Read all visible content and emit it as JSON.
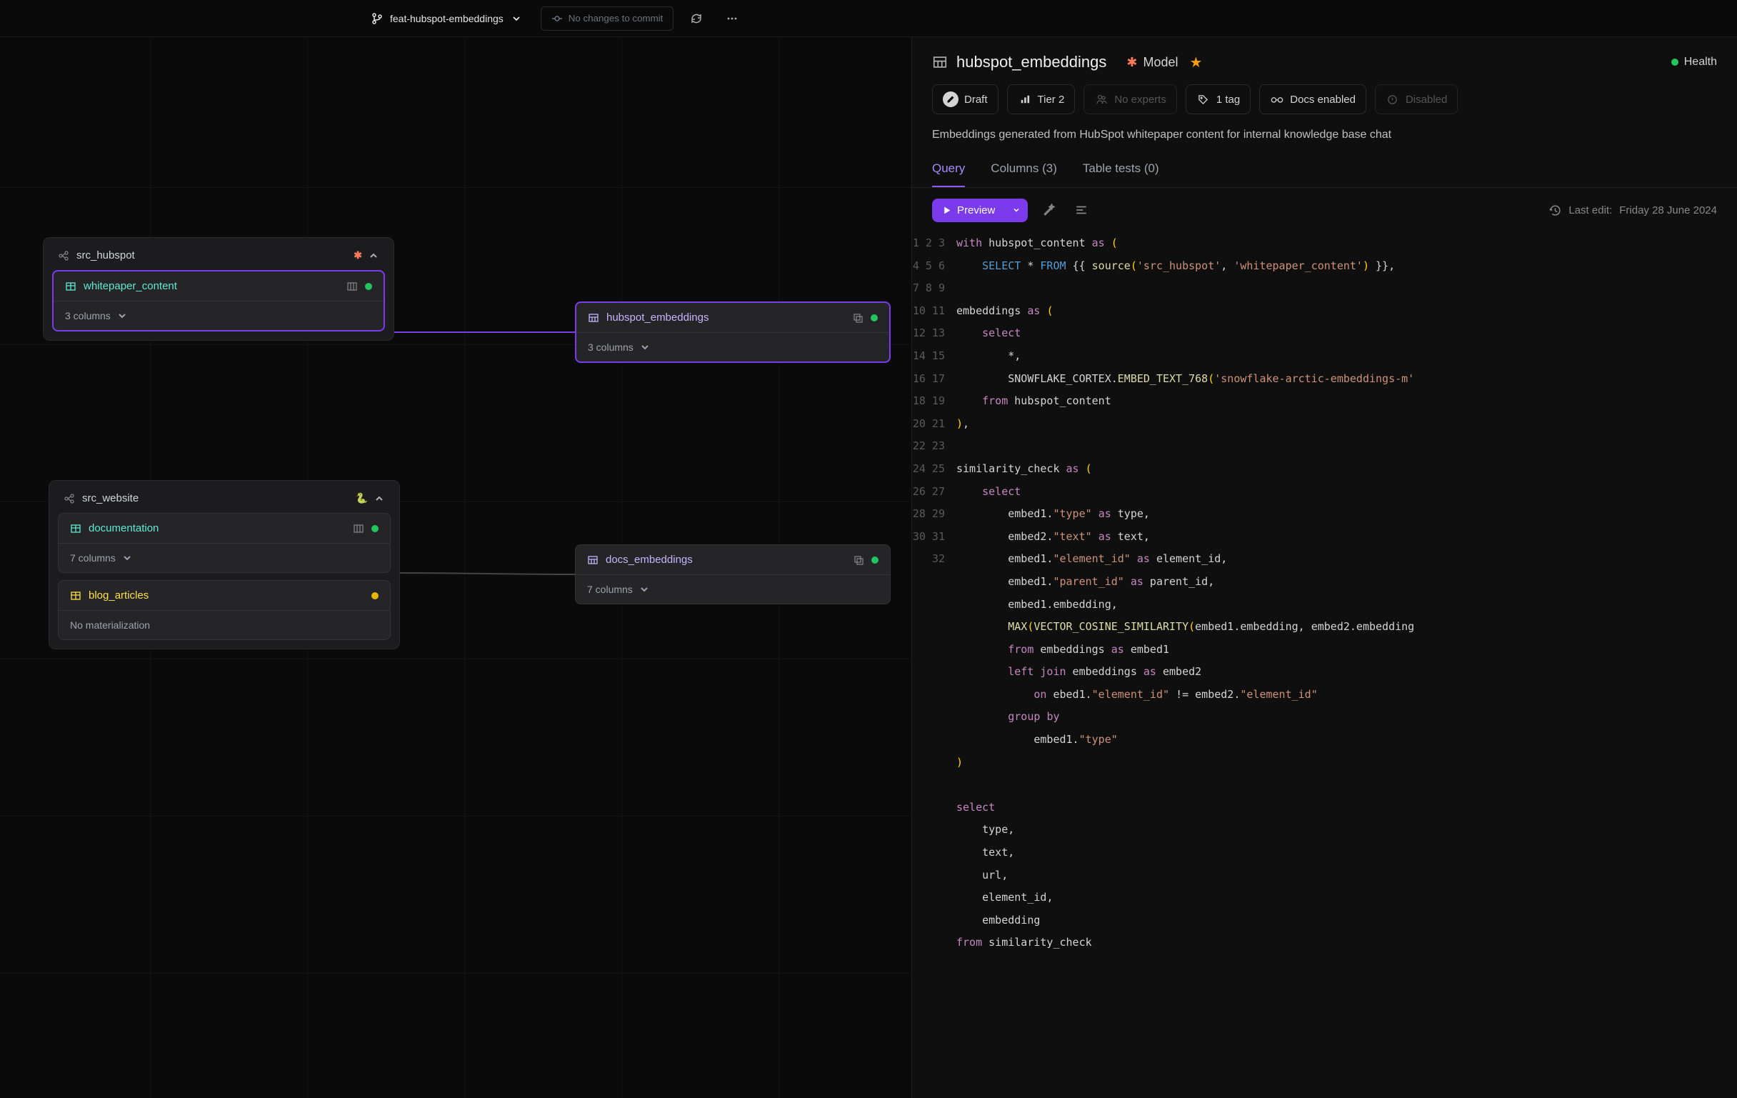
{
  "topbar": {
    "branch": "feat-hubspot-embeddings",
    "commit_msg": "No changes to commit"
  },
  "canvas": {
    "groups": [
      {
        "id": "grp-src-hubspot",
        "title": "src_hubspot",
        "logo": "hubspot",
        "nodes": [
          {
            "id": "whitepaper_content",
            "title": "whitepaper_content",
            "color": "teal",
            "sub": "3 columns",
            "status": "green",
            "selected": true,
            "icon": "table",
            "right_icon": "db"
          }
        ]
      },
      {
        "id": "grp-src-website",
        "title": "src_website",
        "logo": "python",
        "nodes": [
          {
            "id": "documentation",
            "title": "documentation",
            "color": "teal",
            "sub": "7 columns",
            "status": "green",
            "icon": "table",
            "right_icon": "db"
          },
          {
            "id": "blog_articles",
            "title": "blog_articles",
            "color": "yellow",
            "sub": "No materialization",
            "status": "yellow",
            "icon": "table",
            "plain": true
          }
        ]
      }
    ],
    "free_nodes": [
      {
        "id": "hubspot_embeddings",
        "title": "hubspot_embeddings",
        "color": "purple",
        "sub": "3 columns",
        "status": "green",
        "selected": true,
        "icon": "sql",
        "right_icon": "copy"
      },
      {
        "id": "docs_embeddings",
        "title": "docs_embeddings",
        "color": "purple",
        "sub": "7 columns",
        "status": "green",
        "icon": "sql",
        "right_icon": "copy"
      }
    ]
  },
  "panel": {
    "name": "hubspot_embeddings",
    "type": "Model",
    "health": "Health",
    "chips": {
      "draft": "Draft",
      "tier": "Tier 2",
      "experts": "No experts",
      "tag": "1 tag",
      "docs": "Docs enabled",
      "disabled": "Disabled"
    },
    "description": "Embeddings generated from HubSpot whitepaper content for internal knowledge base chat",
    "tabs": {
      "query": "Query",
      "columns": "Columns (3)",
      "tests": "Table tests (0)"
    },
    "toolbar": {
      "preview": "Preview",
      "last_edit_label": "Last edit:",
      "last_edit_value": "Friday 28 June 2024"
    },
    "code": {
      "lines": 32,
      "content_tokens": [
        [
          [
            "kw",
            "with"
          ],
          [
            "pl",
            " hubspot_content "
          ],
          [
            "kw",
            "as"
          ],
          [
            "pl",
            " "
          ],
          [
            "paren",
            "("
          ]
        ],
        [
          [
            "pl",
            "    "
          ],
          [
            "kw2",
            "SELECT"
          ],
          [
            "pl",
            " "
          ],
          [
            "pun",
            "*"
          ],
          [
            "pl",
            " "
          ],
          [
            "kw2",
            "FROM"
          ],
          [
            "pl",
            " "
          ],
          [
            "pun",
            "{{"
          ],
          [
            "pl",
            " "
          ],
          [
            "fn",
            "source"
          ],
          [
            "paren",
            "("
          ],
          [
            "str",
            "'src_hubspot'"
          ],
          [
            "pun",
            ", "
          ],
          [
            "str",
            "'whitepaper_content'"
          ],
          [
            "paren",
            ")"
          ],
          [
            "pl",
            " "
          ],
          [
            "pun",
            "}}"
          ],
          [
            "pun",
            ","
          ]
        ],
        [],
        [
          [
            "pl",
            "embeddings "
          ],
          [
            "kw",
            "as"
          ],
          [
            "pl",
            " "
          ],
          [
            "paren",
            "("
          ]
        ],
        [
          [
            "pl",
            "    "
          ],
          [
            "kw",
            "select"
          ]
        ],
        [
          [
            "pl",
            "        "
          ],
          [
            "pun",
            "*"
          ],
          [
            "pun",
            ","
          ]
        ],
        [
          [
            "pl",
            "        SNOWFLAKE_CORTEX"
          ],
          [
            "pun",
            "."
          ],
          [
            "fn",
            "EMBED_TEXT_768"
          ],
          [
            "paren",
            "("
          ],
          [
            "str",
            "'snowflake-arctic-embeddings-m'"
          ]
        ],
        [
          [
            "pl",
            "    "
          ],
          [
            "kw",
            "from"
          ],
          [
            "pl",
            " hubspot_content"
          ]
        ],
        [
          [
            "paren",
            ")"
          ],
          [
            "pun",
            ","
          ]
        ],
        [],
        [
          [
            "pl",
            "similarity_check "
          ],
          [
            "kw",
            "as"
          ],
          [
            "pl",
            " "
          ],
          [
            "paren",
            "("
          ]
        ],
        [
          [
            "pl",
            "    "
          ],
          [
            "kw",
            "select"
          ]
        ],
        [
          [
            "pl",
            "        embed1."
          ],
          [
            "str",
            "\"type\""
          ],
          [
            "pl",
            " "
          ],
          [
            "kw",
            "as"
          ],
          [
            "pl",
            " type"
          ],
          [
            "pun",
            ","
          ]
        ],
        [
          [
            "pl",
            "        embed2."
          ],
          [
            "str",
            "\"text\""
          ],
          [
            "pl",
            " "
          ],
          [
            "kw",
            "as"
          ],
          [
            "pl",
            " text"
          ],
          [
            "pun",
            ","
          ]
        ],
        [
          [
            "pl",
            "        embed1."
          ],
          [
            "str",
            "\"element_id\""
          ],
          [
            "pl",
            " "
          ],
          [
            "kw",
            "as"
          ],
          [
            "pl",
            " element_id"
          ],
          [
            "pun",
            ","
          ]
        ],
        [
          [
            "pl",
            "        embed1."
          ],
          [
            "str",
            "\"parent_id\""
          ],
          [
            "pl",
            " "
          ],
          [
            "kw",
            "as"
          ],
          [
            "pl",
            " parent_id"
          ],
          [
            "pun",
            ","
          ]
        ],
        [
          [
            "pl",
            "        embed1.embedding"
          ],
          [
            "pun",
            ","
          ]
        ],
        [
          [
            "pl",
            "        "
          ],
          [
            "fn",
            "MAX"
          ],
          [
            "paren",
            "("
          ],
          [
            "fn",
            "VECTOR_COSINE_SIMILARITY"
          ],
          [
            "paren",
            "("
          ],
          [
            "pl",
            "embed1.embedding"
          ],
          [
            "pun",
            ", "
          ],
          [
            "pl",
            "embed2.embedding"
          ]
        ],
        [
          [
            "pl",
            "        "
          ],
          [
            "kw",
            "from"
          ],
          [
            "pl",
            " embeddings "
          ],
          [
            "kw",
            "as"
          ],
          [
            "pl",
            " embed1"
          ]
        ],
        [
          [
            "pl",
            "        "
          ],
          [
            "kw",
            "left"
          ],
          [
            "pl",
            " "
          ],
          [
            "kw",
            "join"
          ],
          [
            "pl",
            " embeddings "
          ],
          [
            "kw",
            "as"
          ],
          [
            "pl",
            " embed2"
          ]
        ],
        [
          [
            "pl",
            "            "
          ],
          [
            "kw",
            "on"
          ],
          [
            "pl",
            " ebed1."
          ],
          [
            "str",
            "\"element_id\""
          ],
          [
            "pl",
            " "
          ],
          [
            "pun",
            "!="
          ],
          [
            "pl",
            " embed2."
          ],
          [
            "str",
            "\"element_id\""
          ]
        ],
        [
          [
            "pl",
            "        "
          ],
          [
            "kw",
            "group"
          ],
          [
            "pl",
            " "
          ],
          [
            "kw",
            "by"
          ]
        ],
        [
          [
            "pl",
            "            embed1."
          ],
          [
            "str",
            "\"type\""
          ]
        ],
        [
          [
            "paren",
            ")"
          ]
        ],
        [],
        [
          [
            "kw",
            "select"
          ]
        ],
        [
          [
            "pl",
            "    type"
          ],
          [
            "pun",
            ","
          ]
        ],
        [
          [
            "pl",
            "    text"
          ],
          [
            "pun",
            ","
          ]
        ],
        [
          [
            "pl",
            "    url"
          ],
          [
            "pun",
            ","
          ]
        ],
        [
          [
            "pl",
            "    element_id"
          ],
          [
            "pun",
            ","
          ]
        ],
        [
          [
            "pl",
            "    embedding"
          ]
        ],
        [
          [
            "kw",
            "from"
          ],
          [
            "pl",
            " similarity_check"
          ]
        ]
      ]
    }
  }
}
